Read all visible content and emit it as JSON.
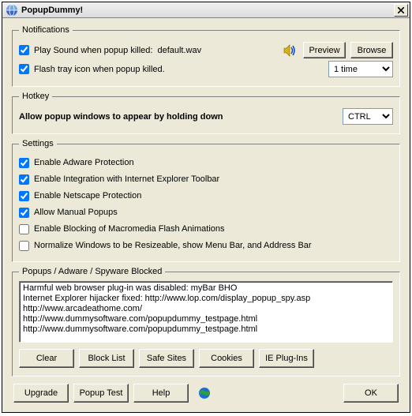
{
  "window": {
    "title": "PopupDummy!"
  },
  "notifications": {
    "legend": "Notifications",
    "play_sound_label": "Play Sound when popup killed:",
    "sound_file": "default.wav",
    "preview_label": "Preview",
    "browse_label": "Browse",
    "flash_tray_label": "Flash tray icon when popup killed.",
    "flash_times_value": "1 time"
  },
  "hotkey": {
    "legend": "Hotkey",
    "label": "Allow popup windows to appear by holding down",
    "value": "CTRL"
  },
  "settings": {
    "legend": "Settings",
    "items": [
      {
        "label": "Enable Adware Protection",
        "checked": true
      },
      {
        "label": "Enable Integration with Internet Explorer Toolbar",
        "checked": true
      },
      {
        "label": "Enable Netscape Protection",
        "checked": true
      },
      {
        "label": "Allow Manual Popups",
        "checked": true
      },
      {
        "label": "Enable Blocking of Macromedia Flash Animations",
        "checked": false
      },
      {
        "label": "Normalize Windows to be Resizeable, show Menu Bar, and Address Bar",
        "checked": false
      }
    ]
  },
  "blocked": {
    "legend": "Popups / Adware / Spyware Blocked",
    "entries": [
      "Harmful web browser plug-in was disabled: myBar BHO",
      "Internet Explorer hijacker fixed: http://www.lop.com/display_popup_spy.asp",
      "http://www.arcadeathome.com/",
      "http://www.dummysoftware.com/popupdummy_testpage.html",
      "http://www.dummysoftware.com/popupdummy_testpage.html"
    ],
    "clear": "Clear",
    "blocklist": "Block List",
    "safesites": "Safe Sites",
    "cookies": "Cookies",
    "plugins": "IE Plug-Ins"
  },
  "footer": {
    "upgrade": "Upgrade",
    "popup_test": "Popup Test",
    "help": "Help",
    "ok": "OK"
  }
}
